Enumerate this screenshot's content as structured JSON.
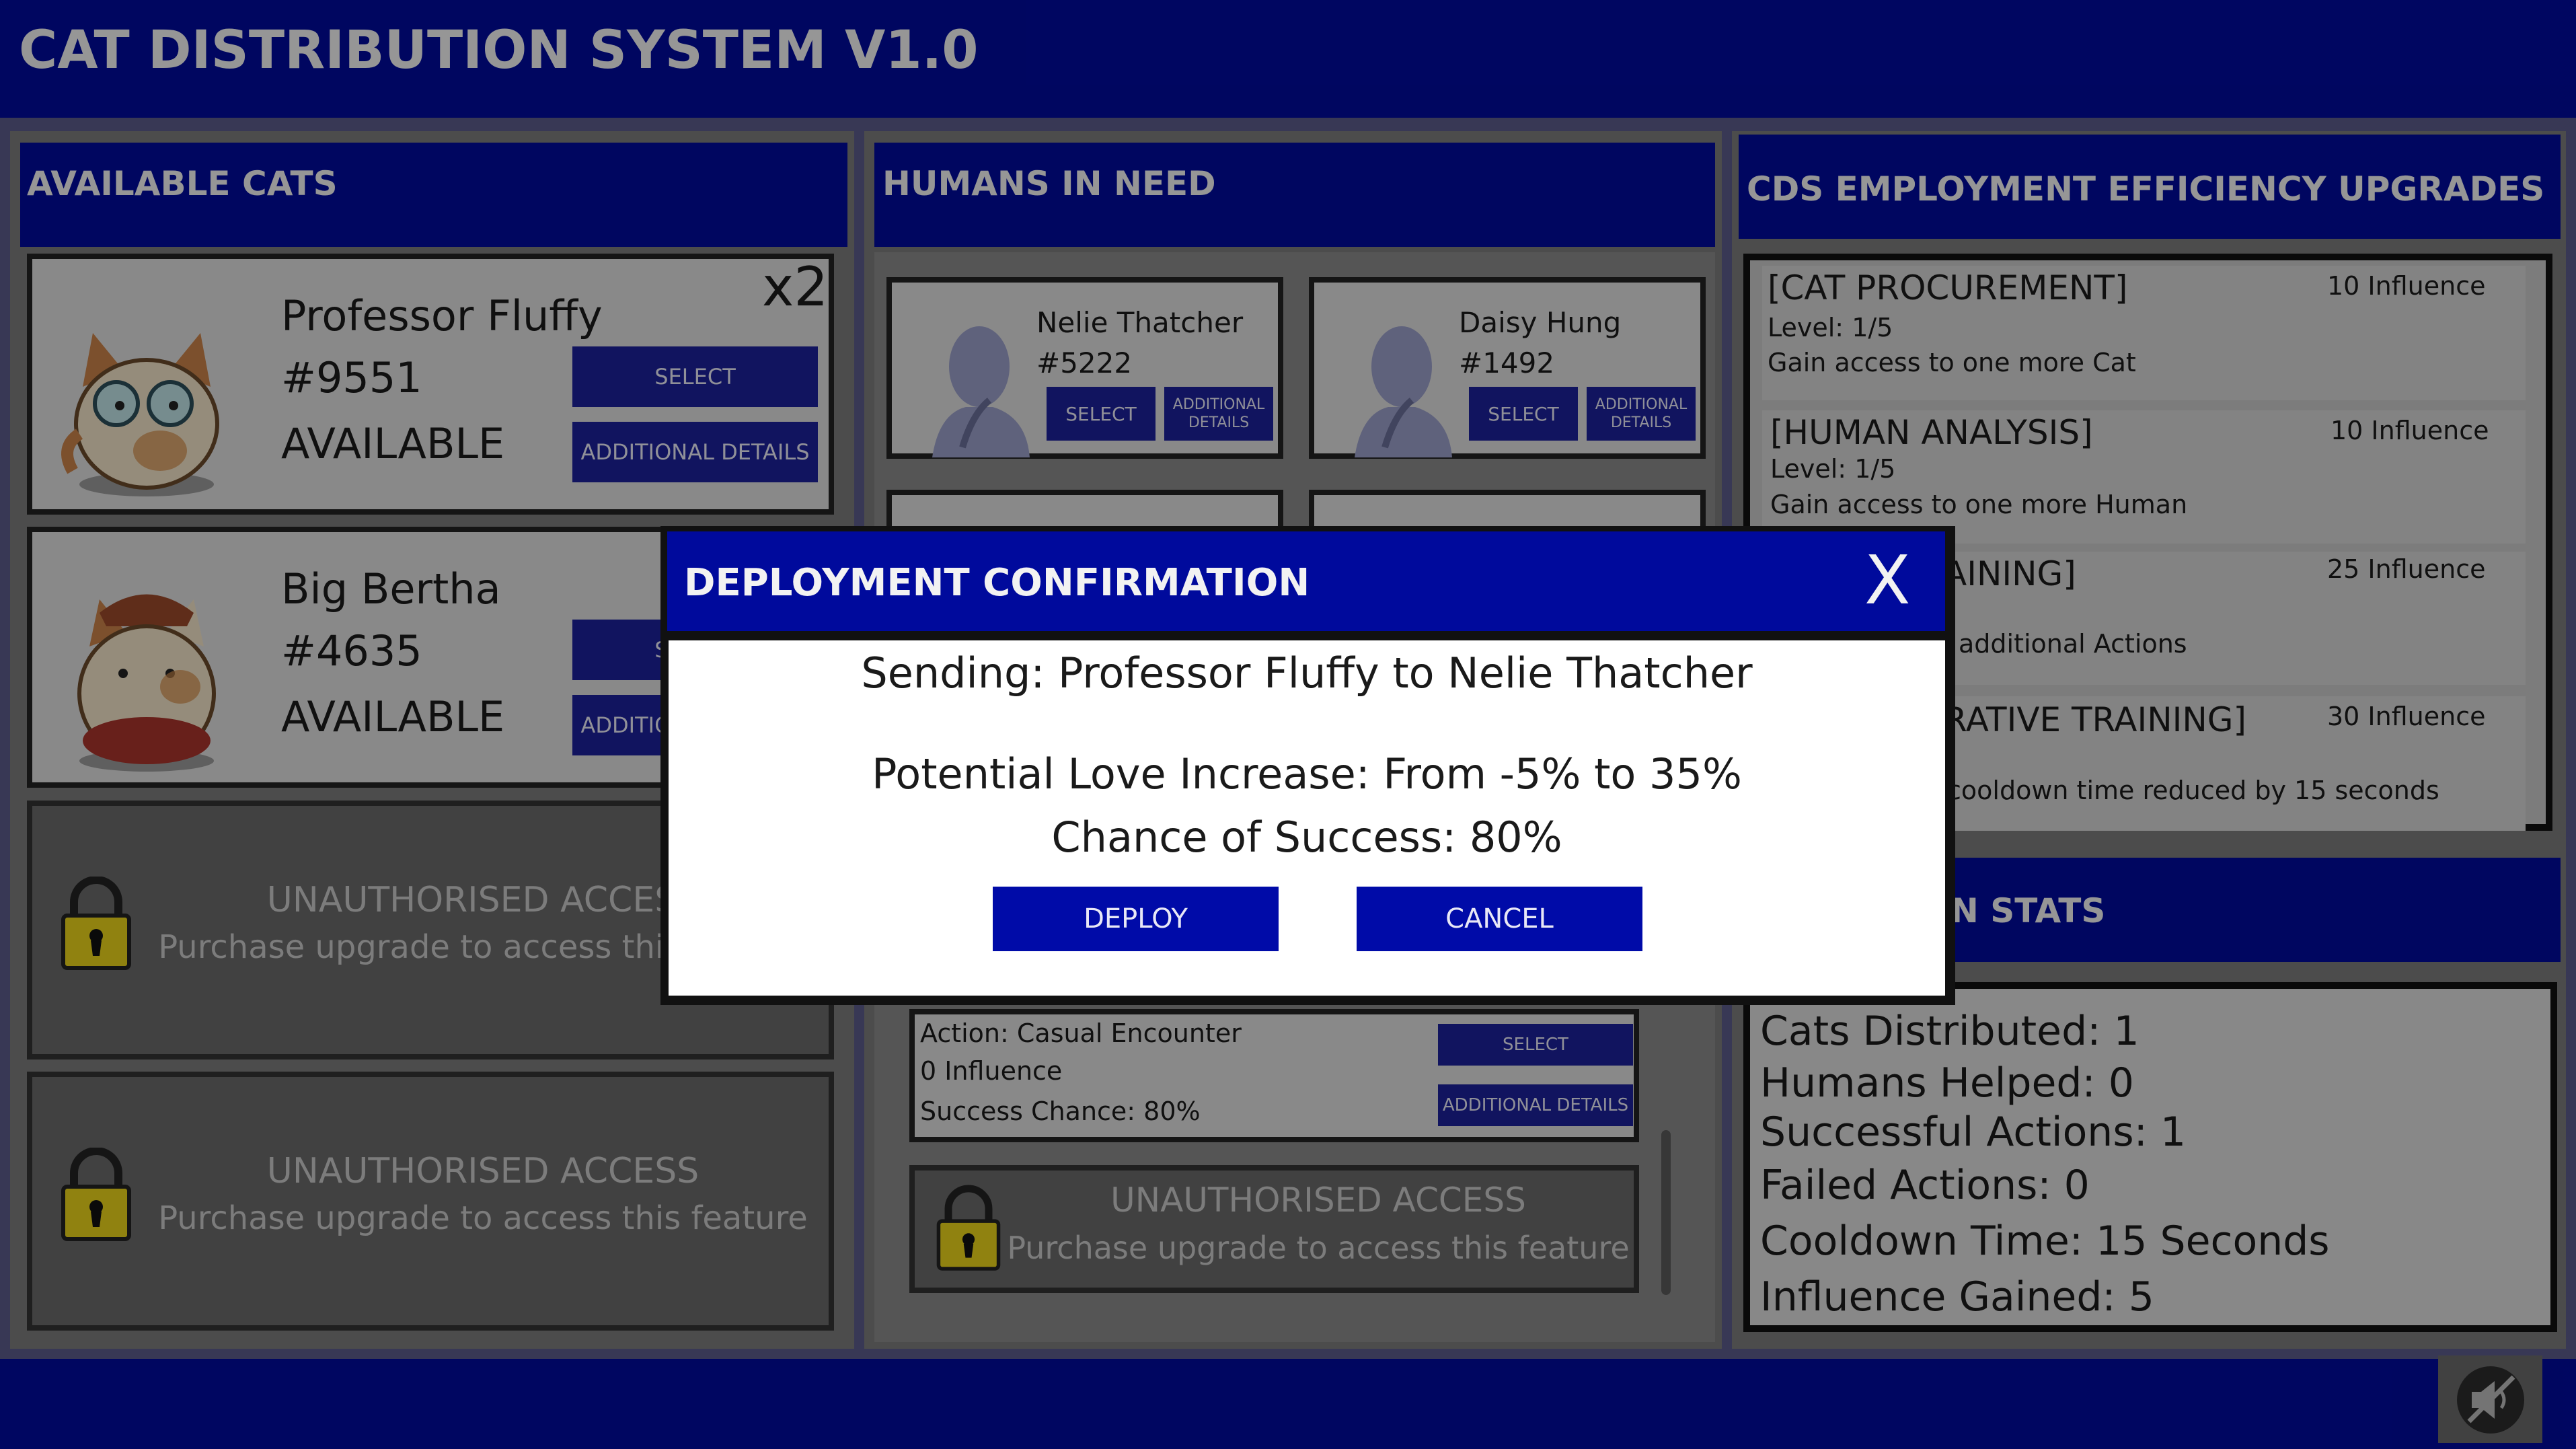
{
  "app": {
    "title": "CAT DISTRIBUTION SYSTEM V1.0"
  },
  "colors": {
    "navy": "#000a9c",
    "panel": "#7b7b7b",
    "card": "#dedede",
    "lock_yellow": "#e8d21a"
  },
  "cats": {
    "header": "AVAILABLE CATS",
    "items": [
      {
        "name": "Professor Fluffy",
        "id": "#9551",
        "status": "AVAILABLE",
        "badge": "x2",
        "select": "SELECT",
        "details": "ADDITIONAL DETAILS"
      },
      {
        "name": "Big Bertha",
        "id": "#4635",
        "status": "AVAILABLE",
        "select": "SELECT",
        "details": "ADDITIONAL DETAILS"
      }
    ],
    "locked": [
      {
        "title": "UNAUTHORISED ACCESS",
        "desc": "Purchase upgrade to access this feature"
      },
      {
        "title": "UNAUTHORISED ACCESS",
        "desc": "Purchase upgrade to access this feature"
      }
    ]
  },
  "humans": {
    "header": "HUMANS IN NEED",
    "items": [
      {
        "name": "Nelie Thatcher",
        "id": "#5222",
        "select": "SELECT",
        "details_line1": "ADDITIONAL",
        "details_line2": "DETAILS"
      },
      {
        "name": "Daisy Hung",
        "id": "#1492",
        "select": "SELECT",
        "details_line1": "ADDITIONAL",
        "details_line2": "DETAILS"
      }
    ],
    "action": {
      "name": "Action: Casual Encounter",
      "cost": "0 Influence",
      "chance": "Success Chance: 80%",
      "select": "SELECT",
      "details": "ADDITIONAL DETAILS"
    },
    "locked": {
      "title": "UNAUTHORISED ACCESS",
      "desc": "Purchase upgrade to access this feature"
    }
  },
  "upgrades": {
    "header": "CDS EMPLOYMENT EFFICIENCY UPGRADES",
    "items": [
      {
        "title": "[CAT PROCUREMENT]",
        "cost": "10 Influence",
        "level": "Level: 1/5",
        "desc": "Gain access to one more Cat"
      },
      {
        "title": "[HUMAN ANALYSIS]",
        "cost": "10 Influence",
        "level": "Level: 1/5",
        "desc": "Gain access to one more Human"
      },
      {
        "title": "AINING]",
        "cost": "25 Influence",
        "level": "",
        "desc": "additional Actions"
      },
      {
        "title": "RATIVE TRAINING]",
        "cost": "30 Influence",
        "level": "",
        "desc": "cooldown time reduced by 15 seconds"
      }
    ]
  },
  "stats": {
    "header": "N STATS",
    "lines": [
      "Cats Distributed: 1",
      "Humans Helped: 0",
      "Successful Actions: 1",
      "Failed Actions: 0",
      "Cooldown Time: 15 Seconds",
      "Influence Gained: 5"
    ]
  },
  "dialog": {
    "title": "DEPLOYMENT CONFIRMATION",
    "close": "X",
    "sending": "Sending: Professor Fluffy to Nelie Thatcher",
    "love": "Potential Love Increase: From -5% to 35%",
    "chance": "Chance of Success: 80%",
    "deploy": "DEPLOY",
    "cancel": "CANCEL"
  },
  "footer": {
    "mute_icon": "speaker-muted-icon"
  }
}
